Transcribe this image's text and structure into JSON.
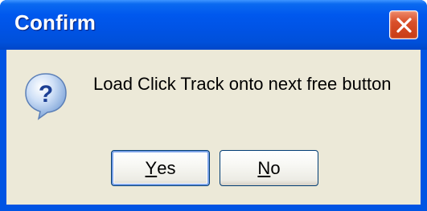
{
  "dialog": {
    "title": "Confirm",
    "message": "Load Click Track onto next free button",
    "icon": "question-icon",
    "buttons": {
      "yes": {
        "mnemonic": "Y",
        "rest": "es"
      },
      "no": {
        "mnemonic": "N",
        "rest": "o"
      }
    },
    "close_icon": "close-icon"
  },
  "colors": {
    "titlebar": "#0054e3",
    "client_bg": "#ece9d8",
    "close_button": "#d9502a"
  }
}
